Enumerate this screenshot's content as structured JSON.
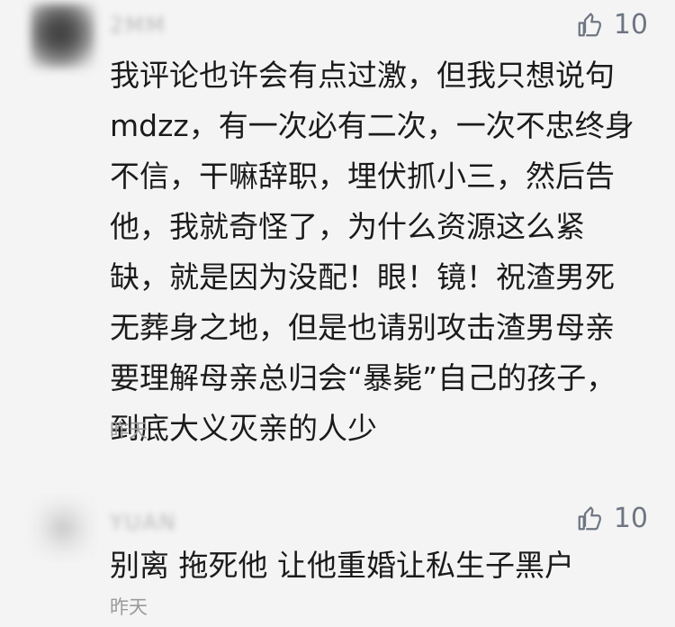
{
  "comments": [
    {
      "username": "2MM",
      "likes": "10",
      "text": "我评论也许会有点过激，但我只想说句\nmdzz，有一次必有二次，一次不忠终身\n不信，干嘛辞职，埋伏抓小三，然后告\n他，我就奇怪了，为什么资源这么紧\n缺，就是因为没配！眼！镜！祝渣男死\n无葬身之地，但是也请别攻击渣男母亲\n要理解母亲总归会“暴毙”自己的孩子，\n到底大义灭亲的人少",
      "time": "昨天"
    },
    {
      "username": "YUAN",
      "likes": "10",
      "text": "别离 拖死他 让他重婚让私生子黑户",
      "time": "昨天"
    }
  ],
  "icons": {
    "like": "thumbs-up-icon"
  },
  "colors": {
    "background": "#f4f4f4",
    "text": "#1b1b1b",
    "meta": "#9a9a9a",
    "like": "#6f7682"
  }
}
